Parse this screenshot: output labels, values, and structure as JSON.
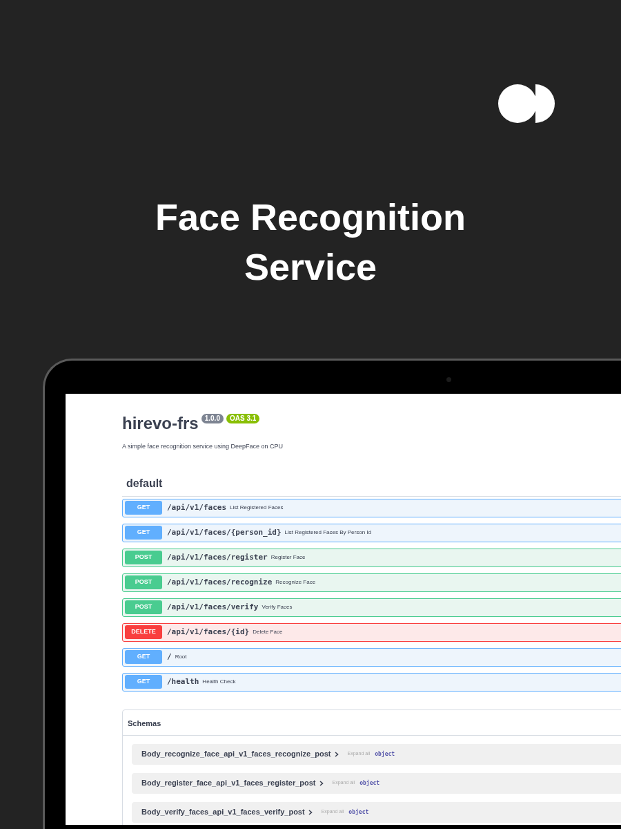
{
  "hero": {
    "title": "Face Recognition Service"
  },
  "api": {
    "title": "hirevo-frs",
    "version": "1.0.0",
    "spec": "OAS 3.1",
    "description": "A simple face recognition service using DeepFace on CPU"
  },
  "section": {
    "title": "default"
  },
  "endpoints": [
    {
      "method": "GET",
      "path": "/api/v1/faces",
      "summary": "List Registered Faces"
    },
    {
      "method": "GET",
      "path": "/api/v1/faces/{person_id}",
      "summary": "List Registered Faces By Person Id"
    },
    {
      "method": "POST",
      "path": "/api/v1/faces/register",
      "summary": "Register Face"
    },
    {
      "method": "POST",
      "path": "/api/v1/faces/recognize",
      "summary": "Recognize Face"
    },
    {
      "method": "POST",
      "path": "/api/v1/faces/verify",
      "summary": "Verify Faces"
    },
    {
      "method": "DELETE",
      "path": "/api/v1/faces/{id}",
      "summary": "Delete Face"
    },
    {
      "method": "GET",
      "path": "/",
      "summary": "Root"
    },
    {
      "method": "GET",
      "path": "/health",
      "summary": "Health Check"
    }
  ],
  "schemas": {
    "title": "Schemas",
    "items": [
      {
        "name": "Body_recognize_face_api_v1_faces_recognize_post",
        "toggle": "Expand all",
        "type": "object"
      },
      {
        "name": "Body_register_face_api_v1_faces_register_post",
        "toggle": "Expand all",
        "type": "object"
      },
      {
        "name": "Body_verify_faces_api_v1_faces_verify_post",
        "toggle": "Expand all",
        "type": "object"
      }
    ]
  }
}
